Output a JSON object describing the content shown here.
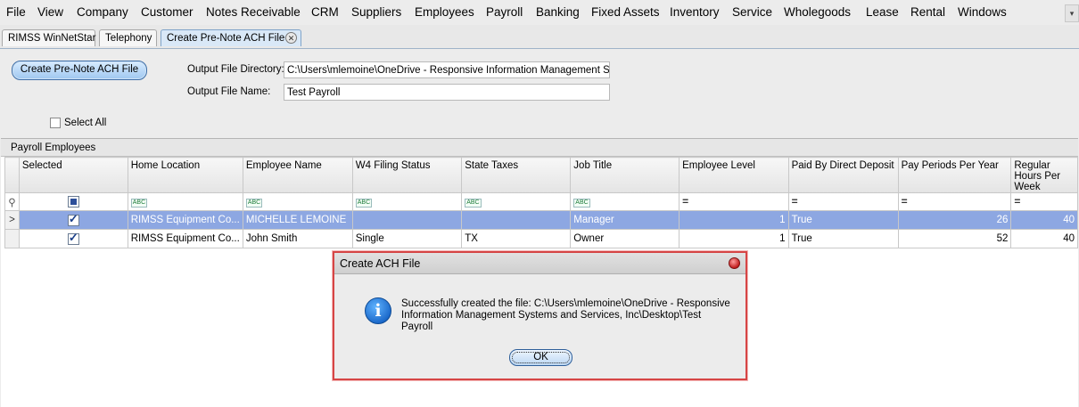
{
  "menubar": {
    "items": [
      "File",
      "View",
      "Company",
      "Customer",
      "Notes Receivable",
      "CRM",
      "Suppliers",
      "Employees",
      "Payroll",
      "Banking",
      "Fixed Assets",
      "Inventory",
      "Service",
      "Wholegoods",
      "Lease",
      "Rental",
      "Windows"
    ],
    "scroll_glyph": "▾"
  },
  "tabs": [
    {
      "label": "RIMSS WinNetStar"
    },
    {
      "label": "Telephony"
    },
    {
      "label": "Create Pre-Note ACH File",
      "active": true
    }
  ],
  "form": {
    "create_button": "Create Pre-Note ACH File",
    "output_dir_label": "Output File Directory:",
    "output_dir_value": "C:\\Users\\mlemoine\\OneDrive - Responsive Information Management Syste",
    "output_name_label": "Output File Name:",
    "output_name_value": "Test Payroll",
    "select_all_label": "Select All"
  },
  "grid": {
    "caption": "Payroll Employees",
    "columns": [
      "Selected",
      "Home Location",
      "Employee Name",
      "W4 Filing Status",
      "State Taxes",
      "Job Title",
      "Employee Level",
      "Paid By Direct Deposit",
      "Pay Periods Per Year",
      "Regular Hours Per Week"
    ],
    "row_indicator": ">",
    "rows": [
      {
        "selected": true,
        "home_location": "RIMSS Equipment Co...",
        "employee_name": "MICHELLE LEMOINE",
        "w4": "",
        "state_taxes": "",
        "job_title": "Manager",
        "level": "1",
        "direct_deposit": "True",
        "pay_periods": "26",
        "hours": "40"
      },
      {
        "selected": true,
        "home_location": "RIMSS Equipment Co...",
        "employee_name": "John Smith",
        "w4": "Single",
        "state_taxes": "TX",
        "job_title": "Owner",
        "level": "1",
        "direct_deposit": "True",
        "pay_periods": "52",
        "hours": "40"
      }
    ]
  },
  "dialog": {
    "title": "Create ACH File",
    "message": "Successfully created the file: C:\\Users\\mlemoine\\OneDrive - Responsive Information Management Systems and Services, Inc\\Desktop\\Test Payroll",
    "ok_label": "OK",
    "icon_glyph": "i"
  },
  "colors": {
    "selected_row": "#8da7e2",
    "dialog_border": "#d64545",
    "button_blue": "#9fc7f0"
  }
}
